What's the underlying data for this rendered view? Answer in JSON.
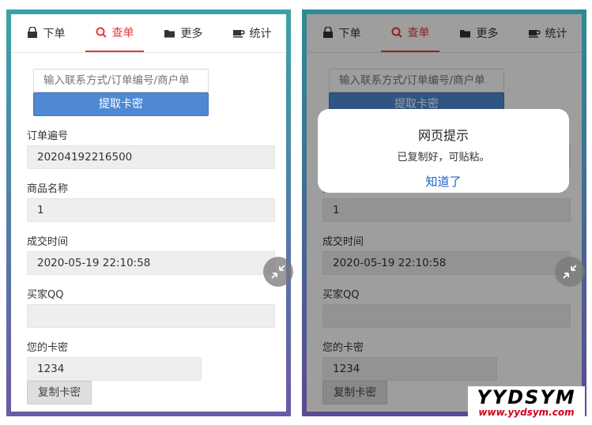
{
  "tabs": [
    {
      "label": "下单",
      "icon": "shopping-bag-icon"
    },
    {
      "label": "查单",
      "icon": "search-icon"
    },
    {
      "label": "更多",
      "icon": "folder-open-icon"
    },
    {
      "label": "统计",
      "icon": "coffee-cup-icon"
    }
  ],
  "search": {
    "placeholder": "输入联系方式/订单编号/商户单"
  },
  "fetch_button": "提取卡密",
  "fields": {
    "order_no_label": "订单遍号",
    "order_no_value": "20204192216500",
    "product_label": "商品名称",
    "product_value": "1",
    "time_label": "成交时间",
    "time_value": "2020-05-19 22:10:58",
    "qq_label": "买家QQ",
    "qq_value": "",
    "card_label": "您的卡密",
    "card_value": "1234"
  },
  "copy_button": "复制卡密",
  "dialog": {
    "title": "网页提示",
    "message": "已复制好，可贴粘。",
    "ok": "知道了"
  },
  "watermark": {
    "logo": "YYDSYM",
    "url": "www.yydsym.com"
  },
  "colors": {
    "accent": "#e4393c",
    "button": "#4f89d4",
    "link": "#1e5fbf"
  }
}
